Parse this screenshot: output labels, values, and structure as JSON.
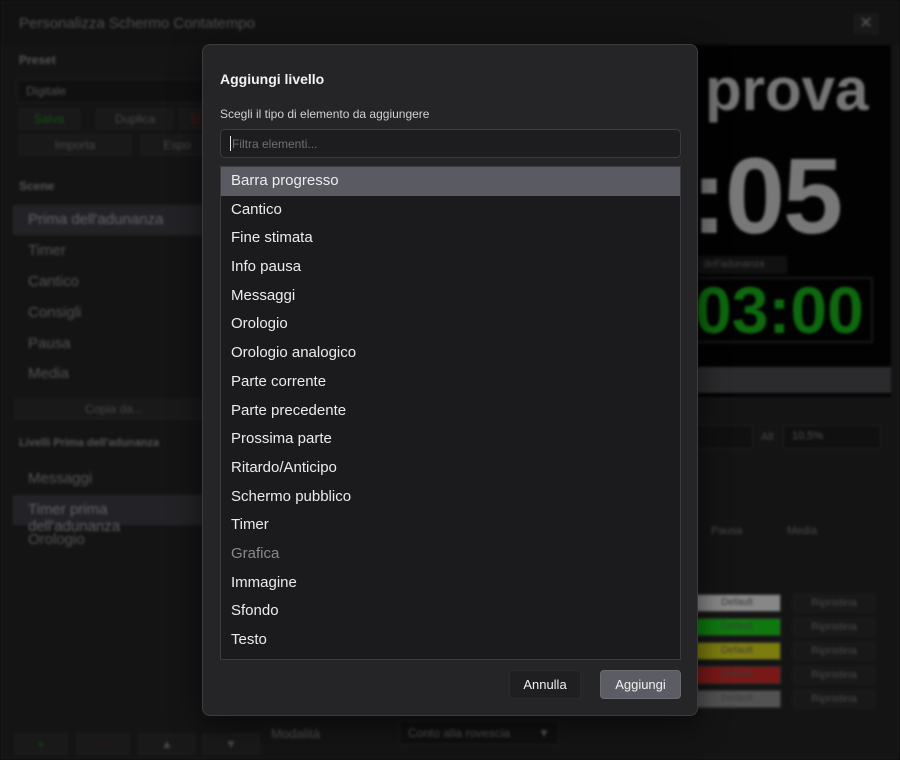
{
  "window": {
    "title": "Personalizza Schermo Contatempo",
    "close_glyph": "✕"
  },
  "left_panel": {
    "preset_heading": "Preset",
    "preset_value": "Digitale",
    "preset_buttons": [
      "Salva",
      "Duplica",
      "El"
    ],
    "io_buttons": [
      "Importa",
      "Espo"
    ],
    "scene_heading": "Scene",
    "scenes": [
      "Prima dell'adunanza",
      "Timer",
      "Cantico",
      "Consigli",
      "Pausa",
      "Media"
    ],
    "copy_button": "Copia da...",
    "levels_heading": "Livelli Prima dell'adunanza",
    "levels": [
      "Messaggi",
      "Timer prima dell'adunanza",
      "Orologio"
    ],
    "bottom_buttons": [
      "+",
      "−",
      "▲",
      "▼"
    ],
    "mode_label": "Modalità",
    "mode_value": "Conto alla rovescia",
    "mode_arrow": "▼"
  },
  "preview": {
    "title_text": "prova",
    "time_text": ":05",
    "tag_text": "dell'adunanza",
    "green_time": "03:00"
  },
  "right_panel": {
    "alt_label": "Alt",
    "alt_value": "10,5%",
    "radio_labels": [
      "Pausa",
      "Media"
    ],
    "swatch_text": "Default",
    "reset_label": "Ripristina",
    "swatch_colors": [
      "#e8e8e8",
      "#1bd01b",
      "#d6d61a",
      "#d22a2a",
      "#8e8e8e"
    ]
  },
  "dialog": {
    "title": "Aggiungi livello",
    "subtitle": "Scegli il tipo di elemento da aggiungere",
    "filter_placeholder": "Filtra elementi...",
    "items": [
      "Barra progresso",
      "Cantico",
      "Fine stimata",
      "Info pausa",
      "Messaggi",
      "Orologio",
      "Orologio analogico",
      "Parte corrente",
      "Parte precedente",
      "Prossima parte",
      "Ritardo/Anticipo",
      "Schermo pubblico",
      "Timer",
      "Grafica",
      "Immagine",
      "Sfondo",
      "Testo"
    ],
    "selected_item": "Barra progresso",
    "cancel_label": "Annulla",
    "add_label": "Aggiungi"
  }
}
